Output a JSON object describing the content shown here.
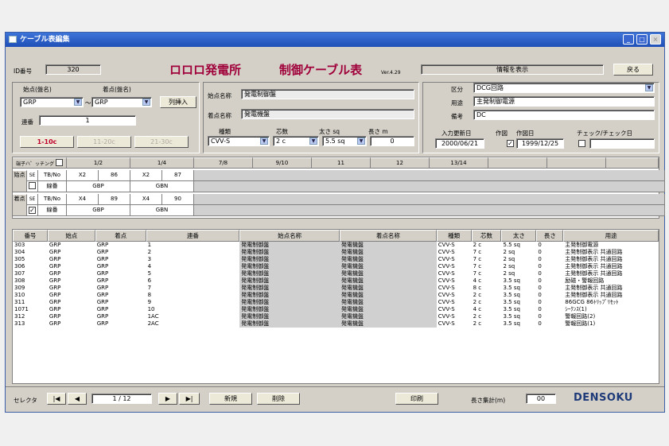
{
  "window": {
    "title": "ケーブル表編集",
    "min": "_",
    "max": "□",
    "close": "×"
  },
  "header": {
    "id_label": "ID番号",
    "id_value": "320",
    "station": "ロロロ発電所",
    "doc_title": "制御ケーブル表",
    "version": "Ver.4.29",
    "status": "情報を表示",
    "return_btn": "戻る"
  },
  "left": {
    "from_label": "始点(盤名)",
    "to_label": "着点(盤名)",
    "from_value": "GRP",
    "to_value": "GRP",
    "dash": "～",
    "insert_btn": "列挿入",
    "serial_label": "連番",
    "serial_value": "1",
    "page_btns": [
      "1-10c",
      "11-20c",
      "21-30c"
    ]
  },
  "names": {
    "from_name_label": "始点名称",
    "from_name_value": "発電制御盤",
    "to_name_label": "着点名称",
    "to_name_value": "発電機盤"
  },
  "specs": {
    "type_label": "種類",
    "cores_label": "芯数",
    "size_label": "太さ",
    "size_unit": "sq",
    "length_label": "長さ",
    "length_unit": "m",
    "type_value": "CVV-S",
    "cores_value": "2 c",
    "size_value": "5.5 sq",
    "length_value": "0"
  },
  "right": {
    "category_label": "区分",
    "category_value": "DCG回路",
    "usage_label": "用途",
    "usage_value": "主発制御電源",
    "note_label": "備考",
    "note_value": "DC",
    "input_date_label": "入力更新日",
    "input_date_value": "2000/06/21",
    "author_label": "作図",
    "author_date_label": "作図日",
    "author_date_value": "1999/12/25",
    "check_label": "チェック/チェック日",
    "check_value": ""
  },
  "terminal": {
    "mapping_label": "端子ハ゜ッチング",
    "columns": [
      "1/2",
      "1/4",
      "7/8",
      "9/10",
      "11",
      "12",
      "13/14"
    ],
    "from_side": "始点",
    "to_side": "着点",
    "tb_label": "TB/No",
    "wire_label": "線番",
    "se_label": "SE",
    "from_tb": [
      "X2",
      "86",
      "X2",
      "87"
    ],
    "from_wire": [
      "GBP",
      "GBN"
    ],
    "to_tb": [
      "X4",
      "89",
      "X4",
      "90"
    ],
    "to_wire": [
      "GBP",
      "GBN"
    ]
  },
  "list": {
    "headers": [
      "番号",
      "始点",
      "着点",
      "連番",
      "始点名称",
      "着点名称",
      "種類",
      "芯数",
      "太さ",
      "長さ",
      "用途"
    ],
    "rows": [
      [
        "303",
        "GRP",
        "GRP",
        "1",
        "発電制御盤",
        "発電機盤",
        "CVV-S",
        "2 c",
        "5.5 sq",
        "0",
        "主発制御電源"
      ],
      [
        "304",
        "GRP",
        "GRP",
        "2",
        "発電制御盤",
        "発電機盤",
        "CVV-S",
        "7 c",
        "2 sq",
        "0",
        "主発制御表示 共通回路"
      ],
      [
        "305",
        "GRP",
        "GRP",
        "3",
        "発電制御盤",
        "発電機盤",
        "CVV-S",
        "7 c",
        "2 sq",
        "0",
        "主発制御表示 共通回路"
      ],
      [
        "306",
        "GRP",
        "GRP",
        "4",
        "発電制御盤",
        "発電機盤",
        "CVV-S",
        "7 c",
        "2 sq",
        "0",
        "主発制御表示 共通回路"
      ],
      [
        "307",
        "GRP",
        "GRP",
        "5",
        "発電制御盤",
        "発電機盤",
        "CVV-S",
        "7 c",
        "2 sq",
        "0",
        "主発制御表示 共通回路"
      ],
      [
        "308",
        "GRP",
        "GRP",
        "6",
        "発電制御盤",
        "発電機盤",
        "CVV-S",
        "4 c",
        "3.5 sq",
        "0",
        "励磁・警報回路"
      ],
      [
        "309",
        "GRP",
        "GRP",
        "7",
        "発電制御盤",
        "発電機盤",
        "CVV-S",
        "8 c",
        "3.5 sq",
        "0",
        "主発制御表示 共通回路"
      ],
      [
        "310",
        "GRP",
        "GRP",
        "8",
        "発電制御盤",
        "発電機盤",
        "CVV-S",
        "2 c",
        "3.5 sq",
        "0",
        "主発制御表示 共通回路"
      ],
      [
        "311",
        "GRP",
        "GRP",
        "9",
        "発電制御盤",
        "発電機盤",
        "CVV-S",
        "2 c",
        "3.5 sq",
        "0",
        "86GCG 86ﾄﾘｯﾌﾟﾘｾｯﾄ"
      ],
      [
        "1071",
        "GRP",
        "GRP",
        "10",
        "発電制御盤",
        "発電機盤",
        "CVV-S",
        "4 c",
        "3.5 sq",
        "0",
        "ｼｰｸﾝｽ(1)"
      ],
      [
        "312",
        "GRP",
        "GRP",
        "1AC",
        "発電制御盤",
        "発電機盤",
        "CVV-S",
        "2 c",
        "3.5 sq",
        "0",
        "警報回路(2)"
      ],
      [
        "313",
        "GRP",
        "GRP",
        "2AC",
        "発電制御盤",
        "発電機盤",
        "CVV-S",
        "2 c",
        "3.5 sq",
        "0",
        "警報回路(1)"
      ]
    ]
  },
  "footer": {
    "selector_label": "セレクタ",
    "first": "|◀",
    "prev": "◀",
    "page": "1 / 12",
    "next": "▶",
    "last": "▶|",
    "new_btn": "新規",
    "delete_btn": "削除",
    "print_btn": "印刷",
    "length_total_label": "長さ集計(m)",
    "length_total_value": "00",
    "brand": "DENSOKU"
  },
  "colors": {
    "title_bar": "#2a5fc8",
    "accent_red": "#a0003a"
  }
}
